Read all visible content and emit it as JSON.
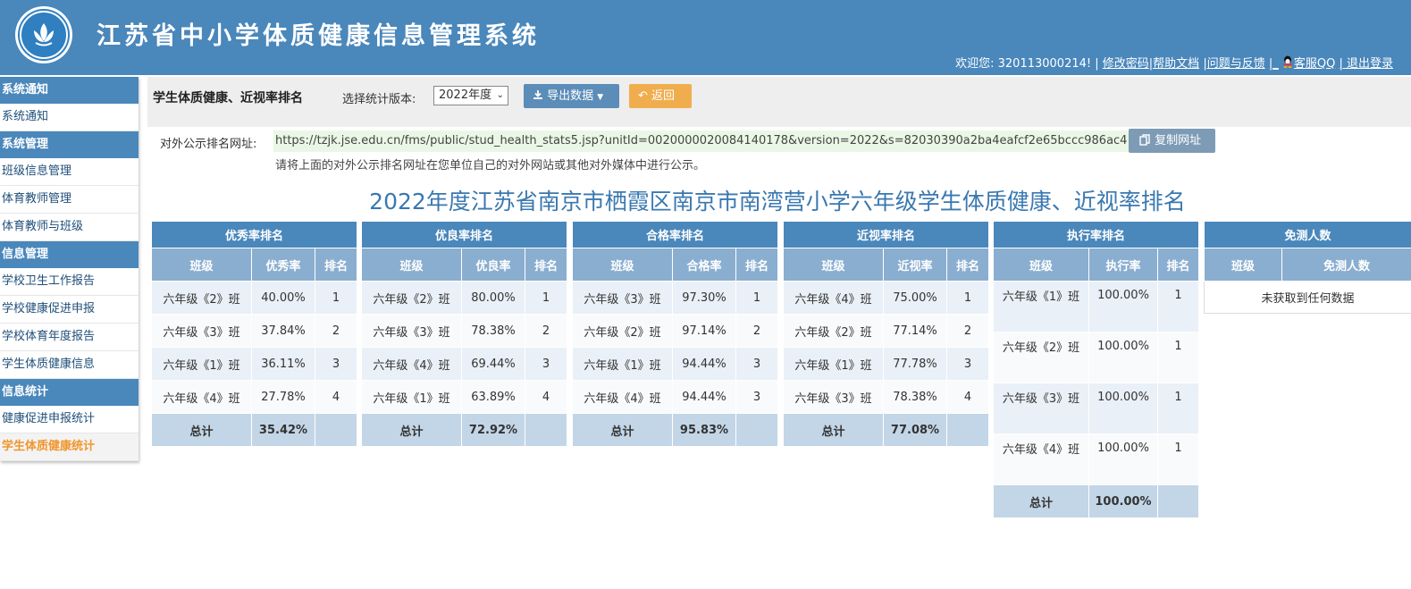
{
  "header": {
    "system_title": "江苏省中小学体质健康信息管理系统",
    "welcome": "欢迎您: 320113000214! |",
    "links": [
      "修改密码",
      "|帮助文档",
      "|问题与反馈",
      "|_",
      "客服QQ",
      "| 退出登录"
    ]
  },
  "sidebar": {
    "groups": [
      {
        "title": "系统通知",
        "items": [
          "系统通知"
        ]
      },
      {
        "title": "系统管理",
        "items": [
          "班级信息管理",
          "体育教师管理",
          "体育教师与班级"
        ]
      },
      {
        "title": "信息管理",
        "items": [
          "学校卫生工作报告",
          "学校健康促进申报",
          "学校体育年度报告",
          "学生体质健康信息"
        ]
      },
      {
        "title": "信息统计",
        "items": [
          "健康促进申报统计",
          "学生体质健康统计"
        ]
      }
    ],
    "active_item": "学生体质健康统计"
  },
  "toolbar": {
    "page_title": "学生体质健康、近视率排名",
    "version_label": "选择统计版本:",
    "version_value": "2022年度",
    "export_label": "导出数据",
    "back_label": "返回"
  },
  "public_url": {
    "label": "对外公示排名网址:",
    "value": "https://tzjk.jse.edu.cn/fms/public/stud_health_stats5.jsp?unitId=0020000020084140178&version=2022&s=82030390a2ba4eafcf2e65bccc986ac4",
    "copy_label": "复制网址",
    "hint": "请将上面的对外公示排名网址在您单位自己的对外网站或其他对外媒体中进行公示。"
  },
  "report_title": "2022年度江苏省南京市栖霞区南京市南湾营小学六年级学生体质健康、近视率排名",
  "tables": {
    "excellent": {
      "title": "优秀率排名",
      "headers": [
        "班级",
        "优秀率",
        "排名"
      ],
      "rows": [
        [
          "六年级《2》班",
          "40.00%",
          "1"
        ],
        [
          "六年级《3》班",
          "37.84%",
          "2"
        ],
        [
          "六年级《1》班",
          "36.11%",
          "3"
        ],
        [
          "六年级《4》班",
          "27.78%",
          "4"
        ]
      ],
      "total": [
        "总计",
        "35.42%",
        ""
      ]
    },
    "good": {
      "title": "优良率排名",
      "headers": [
        "班级",
        "优良率",
        "排名"
      ],
      "rows": [
        [
          "六年级《2》班",
          "80.00%",
          "1"
        ],
        [
          "六年级《3》班",
          "78.38%",
          "2"
        ],
        [
          "六年级《4》班",
          "69.44%",
          "3"
        ],
        [
          "六年级《1》班",
          "63.89%",
          "4"
        ]
      ],
      "total": [
        "总计",
        "72.92%",
        ""
      ]
    },
    "pass": {
      "title": "合格率排名",
      "headers": [
        "班级",
        "合格率",
        "排名"
      ],
      "rows": [
        [
          "六年级《3》班",
          "97.30%",
          "1"
        ],
        [
          "六年级《2》班",
          "97.14%",
          "2"
        ],
        [
          "六年级《1》班",
          "94.44%",
          "3"
        ],
        [
          "六年级《4》班",
          "94.44%",
          "3"
        ]
      ],
      "total": [
        "总计",
        "95.83%",
        ""
      ]
    },
    "myopia": {
      "title": "近视率排名",
      "headers": [
        "班级",
        "近视率",
        "排名"
      ],
      "rows": [
        [
          "六年级《4》班",
          "75.00%",
          "1"
        ],
        [
          "六年级《2》班",
          "77.14%",
          "2"
        ],
        [
          "六年级《1》班",
          "77.78%",
          "3"
        ],
        [
          "六年级《3》班",
          "78.38%",
          "4"
        ]
      ],
      "total": [
        "总计",
        "77.08%",
        ""
      ]
    },
    "execution": {
      "title": "执行率排名",
      "headers": [
        "班级",
        "执行率",
        "排名"
      ],
      "rows": [
        [
          "六年级《1》班",
          "100.00%",
          "1"
        ],
        [
          "六年级《2》班",
          "100.00%",
          "1"
        ],
        [
          "六年级《3》班",
          "100.00%",
          "1"
        ],
        [
          "六年级《4》班",
          "100.00%",
          "1"
        ]
      ],
      "total": [
        "总计",
        "100.00%",
        ""
      ]
    },
    "exempt": {
      "title": "免测人数",
      "headers": [
        "班级",
        "免测人数"
      ],
      "empty_text": "未获取到任何数据"
    }
  }
}
